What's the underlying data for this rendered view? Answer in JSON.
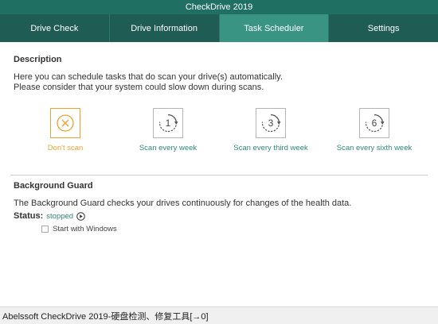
{
  "window": {
    "title": "CheckDrive 2019"
  },
  "tabs": [
    {
      "label": "Drive Check",
      "active": false
    },
    {
      "label": "Drive Information",
      "active": false
    },
    {
      "label": "Task Scheduler",
      "active": true
    },
    {
      "label": "Settings",
      "active": false
    }
  ],
  "description": {
    "title": "Description",
    "line1": "Here you can schedule tasks that do scan your drive(s) automatically.",
    "line2": "Please consider that your system could slow down during scans."
  },
  "schedule_options": [
    {
      "label": "Don't scan",
      "icon": "x-circle-icon",
      "number": "",
      "selected": true
    },
    {
      "label": "Scan every week",
      "icon": "refresh-1-icon",
      "number": "1",
      "selected": false
    },
    {
      "label": "Scan every third week",
      "icon": "refresh-3-icon",
      "number": "3",
      "selected": false
    },
    {
      "label": "Scan every sixth week",
      "icon": "refresh-6-icon",
      "number": "6",
      "selected": false
    }
  ],
  "background_guard": {
    "title": "Background Guard",
    "text": "The Background Guard checks your drives continuously for changes of the health data.",
    "status_label": "Status:",
    "status_value": "stopped",
    "checkbox_label": "Start with Windows",
    "checkbox_checked": false
  },
  "taskbar": {
    "text": "Abelssoft CheckDrive 2019-硬盘检测、修复工具[→0]"
  },
  "colors": {
    "title_bg": "#1f6f63",
    "tab_bg": "#1f5c54",
    "tab_active_bg": "#3a9484",
    "accent_green": "#2c8a78",
    "accent_orange": "#f0a030"
  }
}
